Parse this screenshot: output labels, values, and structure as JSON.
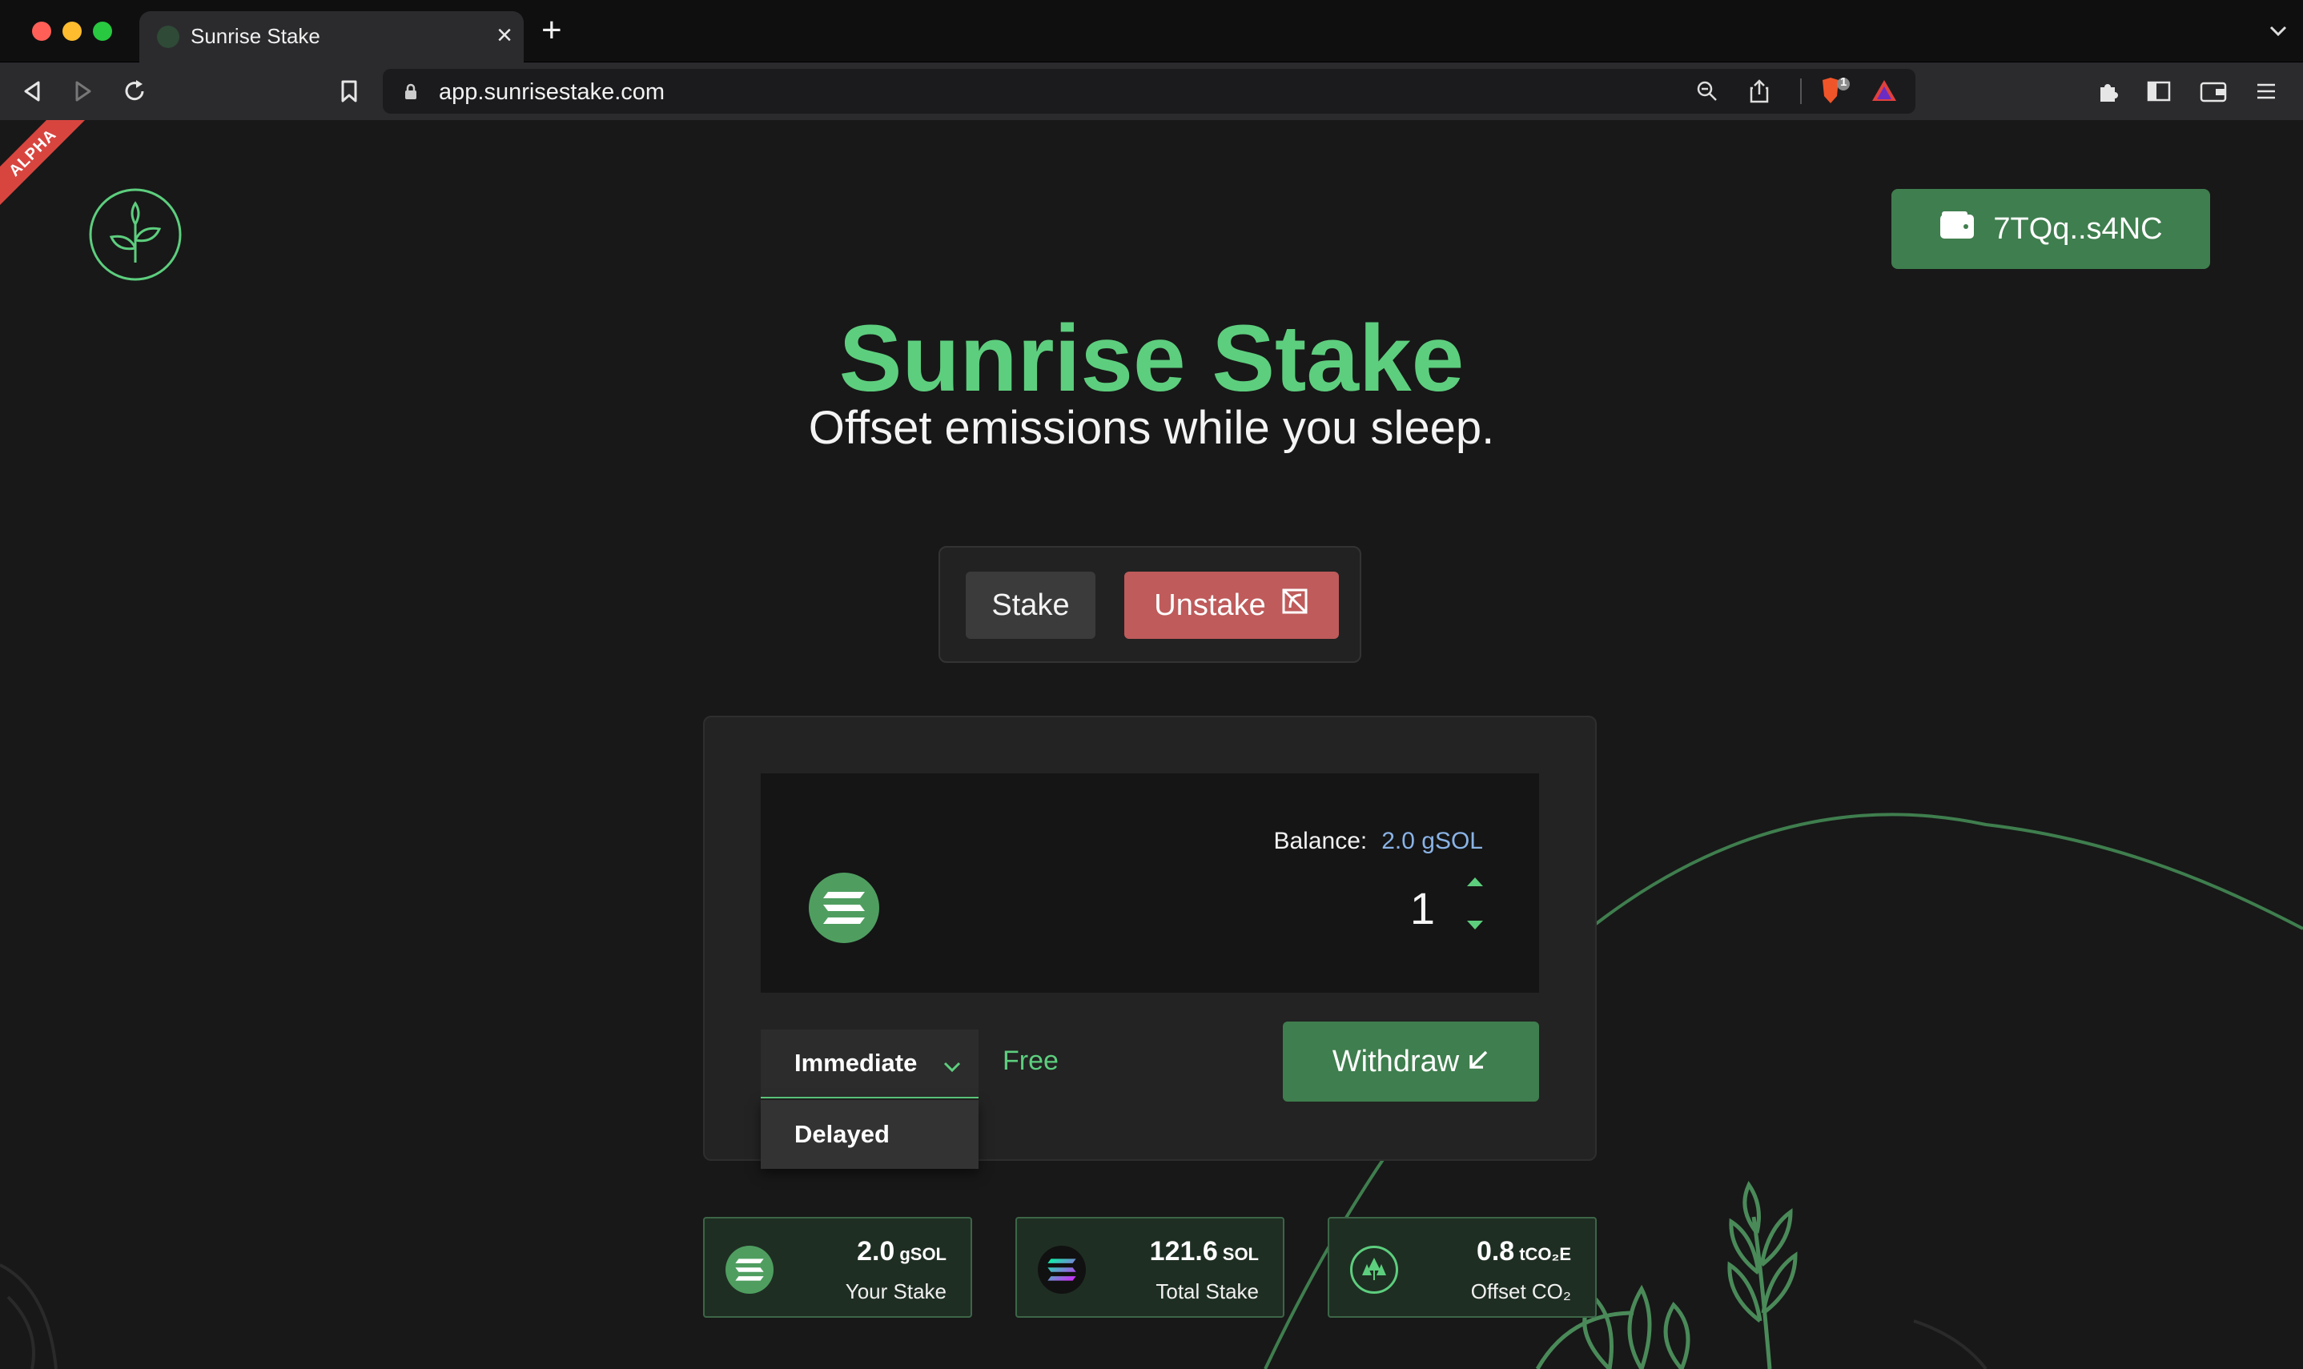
{
  "browser": {
    "tab_title": "Sunrise Stake",
    "url": "app.sunrisestake.com",
    "shield_badge": "1"
  },
  "page": {
    "alpha_ribbon": "ALPHA",
    "wallet_label": "7TQq..s4NC",
    "title": "Sunrise Stake",
    "subtitle": "Offset emissions while you sleep.",
    "mode_stake": "Stake",
    "mode_unstake": "Unstake",
    "balance_label": "Balance:",
    "balance_value": "2.0 gSOL",
    "amount": "1",
    "withdraw_options": {
      "selected": "Immediate",
      "other": "Delayed"
    },
    "fee_label": "Free",
    "withdraw_label": "Withdraw",
    "stats": [
      {
        "value": "2.0",
        "unit": "gSOL",
        "label": "Your Stake"
      },
      {
        "value": "121.6",
        "unit": "SOL",
        "label": "Total Stake"
      },
      {
        "value": "0.8",
        "unit": "tCO₂E",
        "label": "Offset CO₂"
      }
    ],
    "colors": {
      "brand_green": "#5dce7e",
      "button_green": "#3f7e4e",
      "unstake_red": "#bf5b5b",
      "balance_blue": "#8ab3e6",
      "background": "#181818"
    }
  }
}
